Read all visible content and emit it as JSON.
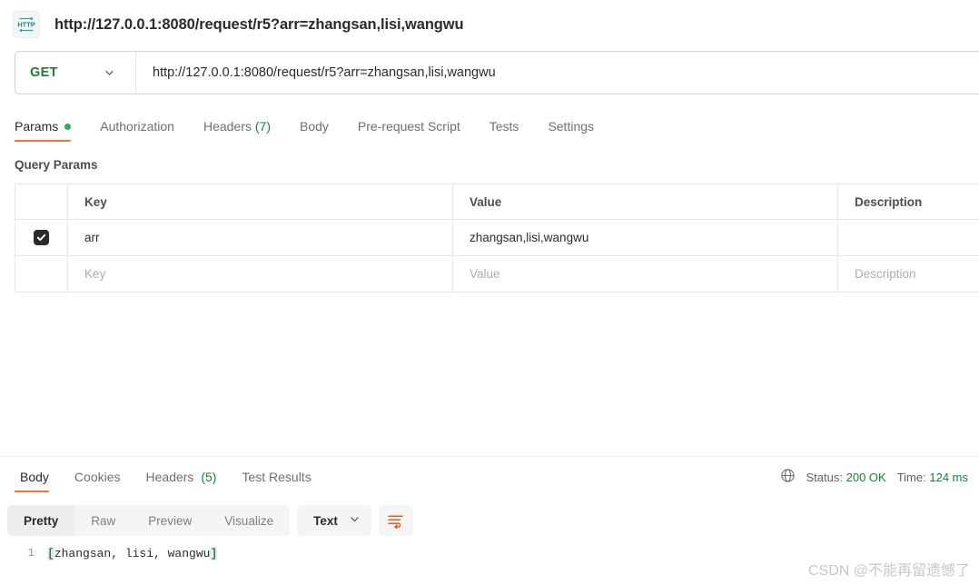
{
  "window": {
    "title": "http://127.0.0.1:8080/request/r5?arr=zhangsan,lisi,wangwu",
    "app_icon": "http-icon",
    "icon_label": "HTTP"
  },
  "request": {
    "method": "GET",
    "method_caret_icon": "chevron-down-icon",
    "url": "http://127.0.0.1:8080/request/r5?arr=zhangsan,lisi,wangwu",
    "tabs": [
      {
        "label": "Params",
        "active": true,
        "dot": true,
        "count": ""
      },
      {
        "label": "Authorization",
        "active": false,
        "dot": false,
        "count": ""
      },
      {
        "label": "Headers",
        "active": false,
        "dot": false,
        "count": "(7)"
      },
      {
        "label": "Body",
        "active": false,
        "dot": false,
        "count": ""
      },
      {
        "label": "Pre-request Script",
        "active": false,
        "dot": false,
        "count": ""
      },
      {
        "label": "Tests",
        "active": false,
        "dot": false,
        "count": ""
      },
      {
        "label": "Settings",
        "active": false,
        "dot": false,
        "count": ""
      }
    ]
  },
  "query_params": {
    "section_label": "Query Params",
    "columns": [
      "Key",
      "Value",
      "Description"
    ],
    "rows": [
      {
        "checked": true,
        "key": "arr",
        "value": "zhangsan,lisi,wangwu",
        "description": "",
        "placeholder_row": false
      },
      {
        "checked": false,
        "key": "Key",
        "value": "Value",
        "description": "Description",
        "placeholder_row": true
      }
    ]
  },
  "response": {
    "tabs": [
      {
        "label": "Body",
        "active": true,
        "count": ""
      },
      {
        "label": "Cookies",
        "active": false,
        "count": ""
      },
      {
        "label": "Headers",
        "active": false,
        "count": "(5)"
      },
      {
        "label": "Test Results",
        "active": false,
        "count": ""
      }
    ],
    "meta": {
      "globe_icon": "globe-icon",
      "status_label": "Status:",
      "status_value": "200 OK",
      "time_label": "Time:",
      "time_value": "124 ms"
    },
    "toolbar": {
      "views": [
        "Pretty",
        "Raw",
        "Preview",
        "Visualize"
      ],
      "active_view": "Pretty",
      "format": "Text",
      "format_caret_icon": "chevron-down-icon",
      "wrap_icon": "wrap-lines-icon"
    },
    "body": {
      "line_number": "1",
      "open_bracket": "[",
      "content": "zhangsan, lisi, wangwu",
      "close_bracket": "]"
    }
  },
  "watermark": "CSDN @不能再留遗憾了",
  "colors": {
    "accent_orange": "#ef7334",
    "green": "#1a7f37",
    "dot_green": "#2cab5b",
    "teal_icon": "#2f9e9e",
    "border": "#e5e7ea"
  }
}
